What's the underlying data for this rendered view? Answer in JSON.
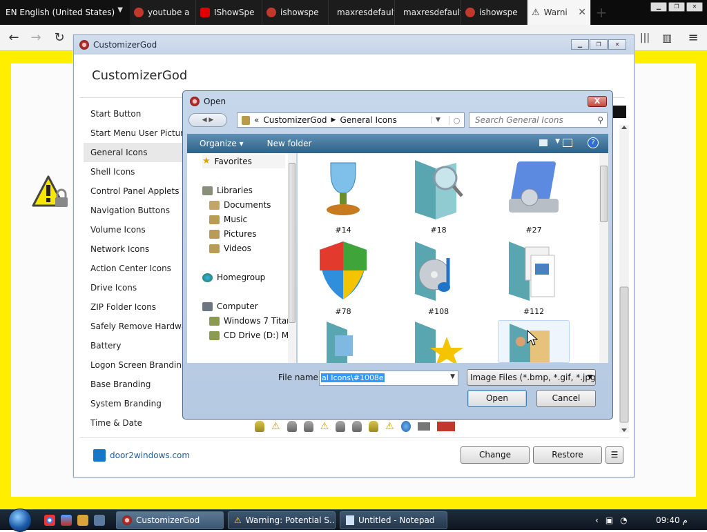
{
  "browser": {
    "language": "EN English (United States)",
    "tabs": [
      {
        "title": "youtube a",
        "color": "#c0392b"
      },
      {
        "title": "IShowSpe",
        "color": "#e00000"
      },
      {
        "title": "ishowspe",
        "color": "#c0392b"
      },
      {
        "title": "maxresdefault",
        "color": ""
      },
      {
        "title": "maxresdefault",
        "color": ""
      },
      {
        "title": "ishowspe",
        "color": "#c0392b"
      },
      {
        "title": "Warni",
        "color": "#222222"
      }
    ],
    "yellow": "#ffee00"
  },
  "customizer": {
    "window_title": "CustomizerGod",
    "heading": "CustomizerGod",
    "menu": [
      "Start Button",
      "Start Menu User Picture F",
      "General Icons",
      "Shell Icons",
      "Control Panel Applets Sid",
      "Navigation Buttons",
      "Volume Icons",
      "Network Icons",
      "Action Center Icons",
      "Drive Icons",
      "ZIP Folder Icons",
      "Safely Remove Hardware",
      "Battery",
      "Logon Screen Branding",
      "Base Branding",
      "System Branding",
      "Time & Date"
    ],
    "selected": "General Icons",
    "footer_link": "door2windows.com",
    "change": "Change",
    "restore": "Restore",
    "menu_button": "☰"
  },
  "dialog": {
    "title": "Open",
    "close": "X",
    "crumb_chev": "«",
    "crumb1": "CustomizerGod",
    "crumb2": "General Icons",
    "search_placeholder": "Search General Icons",
    "organize": "Organize ▾",
    "new_folder": "New folder",
    "help": "?",
    "nav": {
      "favorites": "Favorites",
      "libraries": "Libraries",
      "documents": "Documents",
      "music": "Music",
      "pictures": "Pictures",
      "videos": "Videos",
      "homegroup": "Homegroup",
      "computer": "Computer",
      "drive_c": "Windows 7 Titan",
      "drive_d": "CD Drive (D:) My"
    },
    "files": [
      "#14",
      "#18",
      "#27",
      "#78",
      "#108",
      "#112"
    ],
    "file_name_label": "File name:",
    "file_name_value": "al Icons\\#1008e",
    "file_type": "Image Files (*.bmp, *.gif, *.jpg,",
    "open": "Open",
    "cancel": "Cancel"
  },
  "taskbar": {
    "items": [
      "CustomizerGod",
      "Warning: Potential S...",
      "Untitled - Notepad"
    ],
    "clock": "09:40 م"
  }
}
